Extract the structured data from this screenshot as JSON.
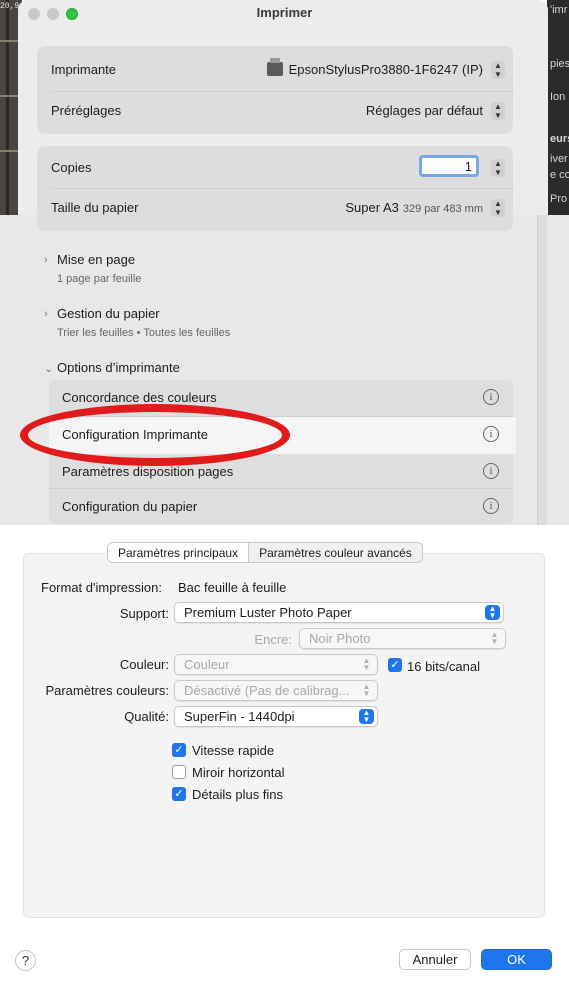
{
  "window": {
    "title": "Imprimer"
  },
  "desktop": {
    "left_snippet": "20,9",
    "right_snippets": [
      "'imr",
      "pies",
      "Ion",
      "eurs",
      "iver",
      "e co",
      "Pro"
    ]
  },
  "printer_group": {
    "printer_label": "Imprimante",
    "printer_value": "EpsonStylusPro3880-1F6247 (IP)",
    "presets_label": "Préréglages",
    "presets_value": "Réglages par défaut"
  },
  "copies_group": {
    "copies_label": "Copies",
    "copies_value": "1",
    "paper_label": "Taille du papier",
    "paper_value": "Super A3",
    "paper_dims": "329 par 483 mm"
  },
  "sections": [
    {
      "title": "Mise en page",
      "subtitle": "1 page par feuille"
    },
    {
      "title": "Gestion du papier",
      "subtitle": "Trier les feuilles • Toutes les feuilles"
    },
    {
      "title": "Options d’imprimante"
    }
  ],
  "printer_options": [
    {
      "label": "Concordance des couleurs"
    },
    {
      "label": "Configuration Imprimante"
    },
    {
      "label": "Paramètres disposition pages"
    },
    {
      "label": "Configuration du papier"
    }
  ],
  "tabs": [
    {
      "label": "Paramètres principaux"
    },
    {
      "label": "Paramètres couleur avancés"
    }
  ],
  "settings": {
    "format_label": "Format d'impression:",
    "format_value": "Bac feuille à feuille",
    "support_label": "Support:",
    "support_value": "Premium Luster Photo Paper",
    "ink_label": "Encre:",
    "ink_value": "Noir Photo",
    "color_label": "Couleur:",
    "color_value": "Couleur",
    "bits_label": "16 bits/canal",
    "colorsettings_label": "Paramètres couleurs:",
    "colorsettings_value": "Désactivé (Pas de calibrag...",
    "quality_label": "Qualité:",
    "quality_value": "SuperFin - 1440dpi"
  },
  "checkboxes": [
    {
      "label": "Vitesse rapide",
      "checked": true
    },
    {
      "label": "Miroir horizontal",
      "checked": false
    },
    {
      "label": "Détails plus fins",
      "checked": true
    }
  ],
  "footer": {
    "help": "?",
    "cancel": "Annuler",
    "ok": "OK"
  },
  "colors": {
    "accent": "#1e76ea",
    "annotation": "#e11b1b"
  }
}
